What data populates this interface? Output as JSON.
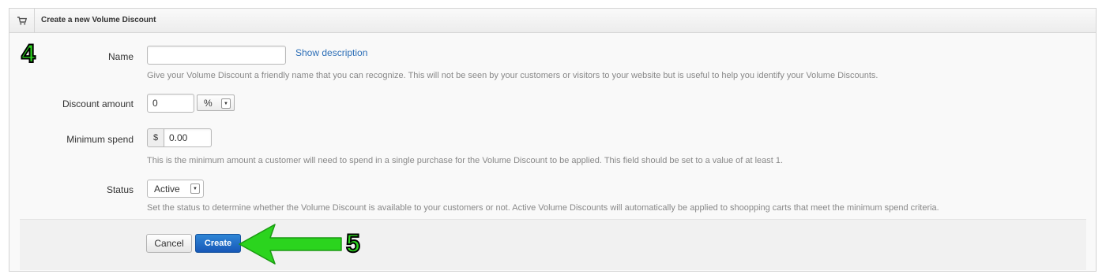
{
  "header": {
    "title": "Create a new Volume Discount",
    "icon": "cart-icon"
  },
  "annotations": {
    "step_top": "4",
    "step_bottom": "5",
    "arrow_color": "#2bd41e"
  },
  "form": {
    "name": {
      "label": "Name",
      "value": "",
      "link": "Show description",
      "help": "Give your Volume Discount a friendly name that you can recognize. This will not be seen by your customers or visitors to your website but is useful to help you identify your Volume Discounts."
    },
    "discount_amount": {
      "label": "Discount amount",
      "value": "0",
      "unit": "%"
    },
    "minimum_spend": {
      "label": "Minimum spend",
      "currency": "$",
      "value": "0.00",
      "help": "This is the minimum amount a customer will need to spend in a single purchase for the Volume Discount to be applied. This field should be set to a value of at least 1."
    },
    "status": {
      "label": "Status",
      "value": "Active",
      "help": "Set the status to determine whether the Volume Discount is available to your customers or not. Active Volume Discounts will automatically be applied to shoopping carts that meet the minimum spend criteria."
    }
  },
  "actions": {
    "cancel": "Cancel",
    "create": "Create"
  },
  "colors": {
    "link": "#2d6fb7",
    "primary": "#1f6cc7"
  }
}
